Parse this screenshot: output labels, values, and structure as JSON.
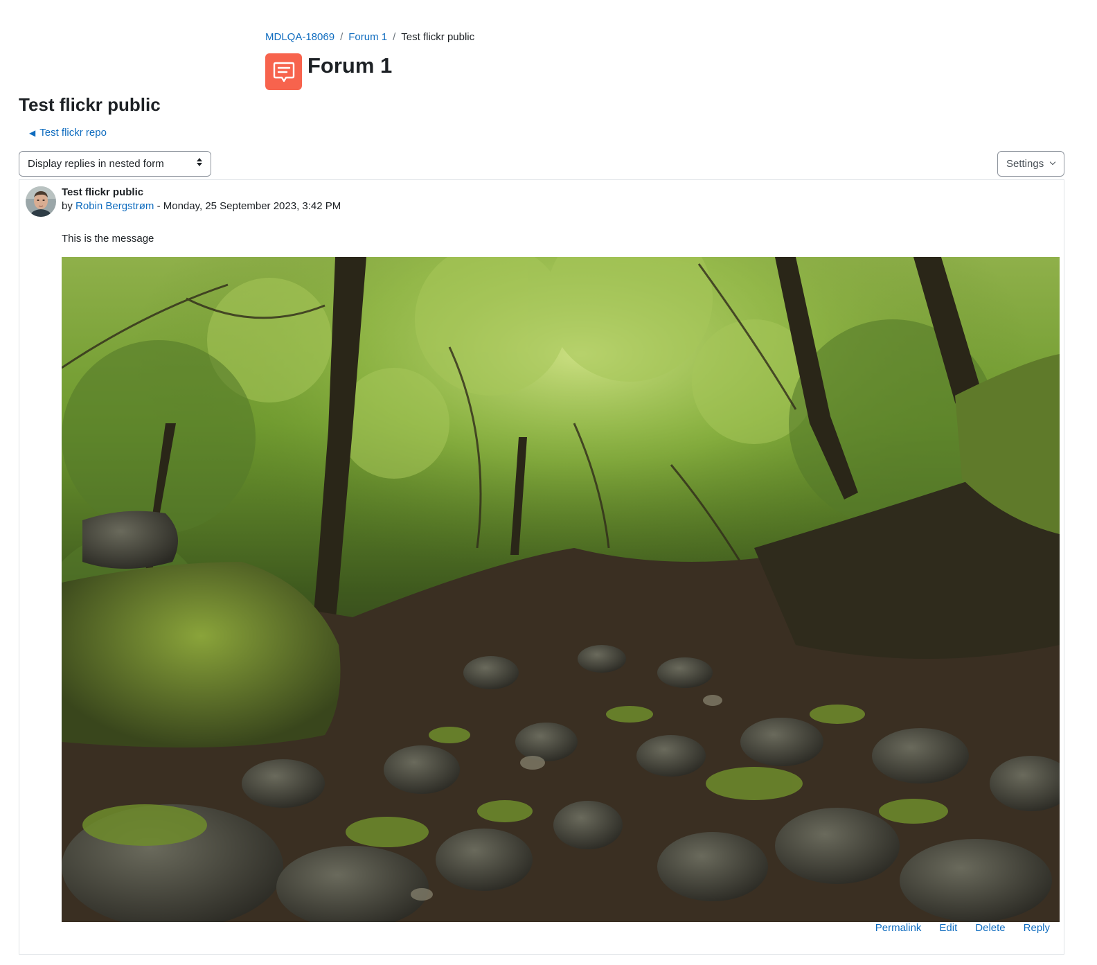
{
  "breadcrumb": {
    "items": [
      {
        "label": "MDLQA-18069"
      },
      {
        "label": "Forum 1"
      }
    ],
    "current": "Test flickr public",
    "separator": "/"
  },
  "activity": {
    "icon": "forum-speech-bubble-icon",
    "icon_color": "#f7634d",
    "title": "Forum 1"
  },
  "discussion": {
    "title": "Test flickr public"
  },
  "navigation": {
    "back_label": "Test flickr repo",
    "back_icon": "left-triangle-icon"
  },
  "controls": {
    "display_mode": "Display replies in nested form",
    "settings_label": "Settings"
  },
  "post": {
    "subject": "Test flickr public",
    "by_prefix": "by",
    "author": "Robin Bergstrøm",
    "date_separator": "-",
    "date": "Monday, 25 September 2023, 3:42 PM",
    "message": "This is the message",
    "image": "forest-rocky-stream-photo",
    "actions": {
      "permalink": "Permalink",
      "edit": "Edit",
      "delete": "Delete",
      "reply": "Reply"
    }
  },
  "colors": {
    "link": "#0f6cbf",
    "text": "#1d2125",
    "border": "#dee2e6"
  }
}
